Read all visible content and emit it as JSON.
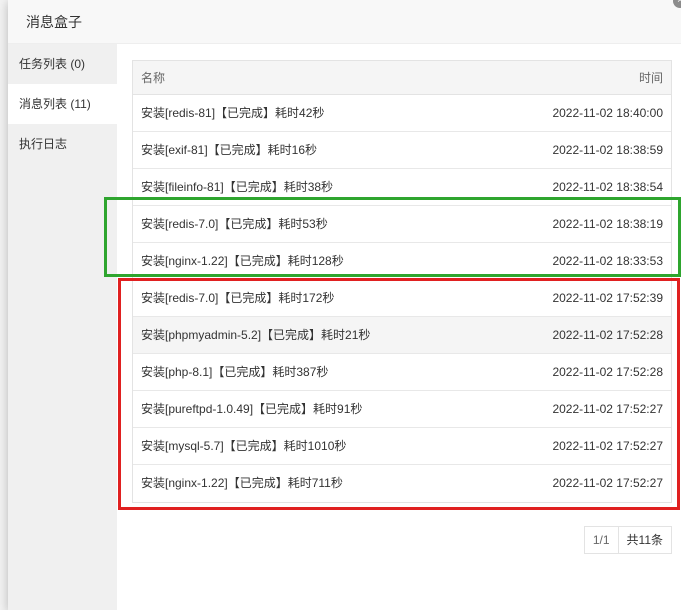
{
  "dialog": {
    "title": "消息盒子",
    "close_glyph": "×"
  },
  "sidebar": {
    "items": [
      {
        "label": "任务列表 (0)"
      },
      {
        "label": "消息列表 (11)"
      },
      {
        "label": "执行日志"
      }
    ],
    "active_index": 1
  },
  "table": {
    "headers": {
      "name": "名称",
      "time": "时间"
    },
    "rows": [
      {
        "name": "安装[redis-81]【已完成】耗时42秒",
        "time": "2022-11-02 18:40:00"
      },
      {
        "name": "安装[exif-81]【已完成】耗时16秒",
        "time": "2022-11-02 18:38:59"
      },
      {
        "name": "安装[fileinfo-81]【已完成】耗时38秒",
        "time": "2022-11-02 18:38:54"
      },
      {
        "name": "安装[redis-7.0]【已完成】耗时53秒",
        "time": "2022-11-02 18:38:19"
      },
      {
        "name": "安装[nginx-1.22]【已完成】耗时128秒",
        "time": "2022-11-02 18:33:53"
      },
      {
        "name": "安装[redis-7.0]【已完成】耗时172秒",
        "time": "2022-11-02 17:52:39"
      },
      {
        "name": "安装[phpmyadmin-5.2]【已完成】耗时21秒",
        "time": "2022-11-02 17:52:28"
      },
      {
        "name": "安装[php-8.1]【已完成】耗时387秒",
        "time": "2022-11-02 17:52:28"
      },
      {
        "name": "安装[pureftpd-1.0.49]【已完成】耗时91秒",
        "time": "2022-11-02 17:52:27"
      },
      {
        "name": "安装[mysql-5.7]【已完成】耗时1010秒",
        "time": "2022-11-02 17:52:27"
      },
      {
        "name": "安装[nginx-1.22]【已完成】耗时711秒",
        "time": "2022-11-02 17:52:27"
      }
    ],
    "hover_row_index": 6
  },
  "pager": {
    "current": "1/1",
    "total": "共11条"
  },
  "colors": {
    "highlight_green": "#2ea52e",
    "highlight_red": "#e02020"
  }
}
